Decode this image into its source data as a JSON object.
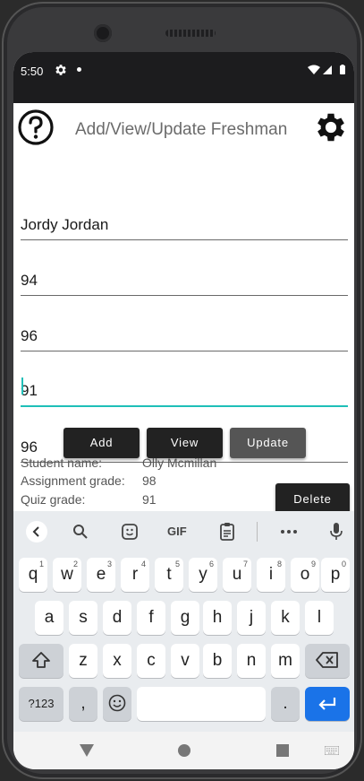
{
  "status": {
    "time": "5:50"
  },
  "app": {
    "title": "Add/View/Update Freshman",
    "fields": [
      "Jordy Jordan",
      "94",
      "96",
      "91",
      "96"
    ],
    "buttons": {
      "add": "Add",
      "view": "View",
      "update": "Update",
      "delete": "Delete"
    },
    "info": {
      "name_label": "Student name:",
      "name_value": "Olly Mcmillan",
      "assignment_label": "Assignment grade:",
      "assignment_value": "98",
      "quiz_label": "Quiz grade:",
      "quiz_value": "91"
    }
  },
  "keyboard": {
    "gif_label": "GIF",
    "row1": [
      "q",
      "w",
      "e",
      "r",
      "t",
      "y",
      "u",
      "i",
      "o",
      "p"
    ],
    "row1_hints": [
      "1",
      "2",
      "3",
      "4",
      "5",
      "6",
      "7",
      "8",
      "9",
      "0"
    ],
    "row2": [
      "a",
      "s",
      "d",
      "f",
      "g",
      "h",
      "j",
      "k",
      "l"
    ],
    "row3": [
      "z",
      "x",
      "c",
      "v",
      "b",
      "n",
      "m"
    ],
    "symbols_label": "?123",
    "comma": ",",
    "period": ".",
    "enter_icon": "enter-arrow-icon",
    "accent": "#1a73e8"
  },
  "colors": {
    "focus": "#1fbfb8",
    "button": "#222222",
    "update_button": "#555555"
  }
}
